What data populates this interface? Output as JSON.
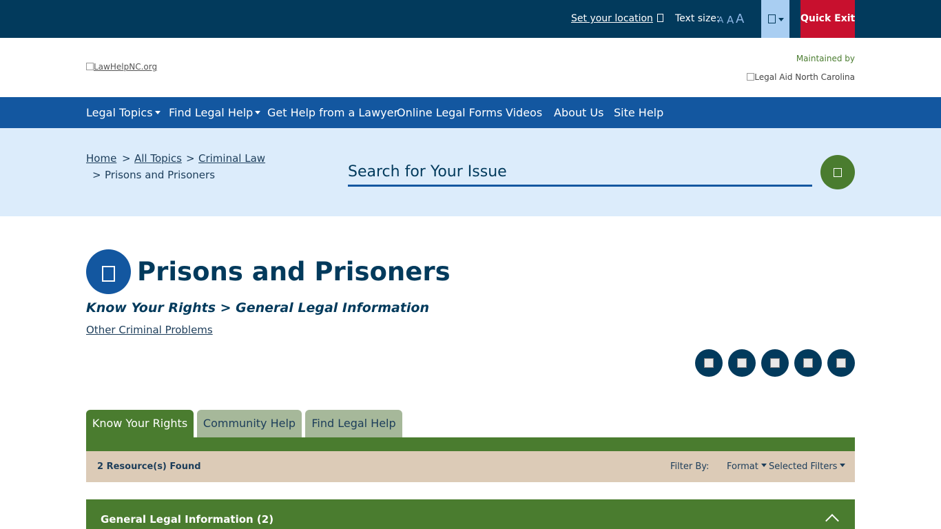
{
  "topbar": {
    "location_link": "Set your location",
    "text_size_label": "Text size:",
    "text_size_options": [
      "A",
      "A",
      "A"
    ],
    "quick_exit": "Quick Exit"
  },
  "header": {
    "logo_alt": "LawHelpNC.org",
    "maintained_by": "Maintained by",
    "partner_alt": "Legal Aid North Carolina"
  },
  "nav": {
    "items": [
      "Legal Topics",
      "Find Legal Help",
      "Get Help from a Lawyer",
      "Online Legal Forms",
      "Videos",
      "About Us",
      "Site Help"
    ]
  },
  "breadcrumb": {
    "home": "Home",
    "all_topics": "All Topics",
    "criminal_law": "Criminal Law",
    "current": "Prisons and Prisoners",
    "separator": ">"
  },
  "search": {
    "placeholder": "Search for Your Issue"
  },
  "page": {
    "title": "Prisons and Prisoners",
    "subtitle": "Know Your Rights > General Legal Information",
    "related_link": "Other Criminal Problems"
  },
  "tabs": [
    "Know Your Rights",
    "Community Help",
    "Find Legal Help"
  ],
  "filters": {
    "results": "2 Resource(s) Found",
    "filter_by": "Filter By:",
    "format": "Format",
    "selected": "Selected Filters"
  },
  "accordion": {
    "title": "General Legal Information (2)"
  },
  "colors": {
    "topbar": "#023a5c",
    "nav": "#1357a0",
    "band": "#dcecfb",
    "green": "#4a7c2f",
    "quick_exit": "#c8102e",
    "filterbar": "#dccbb7"
  }
}
